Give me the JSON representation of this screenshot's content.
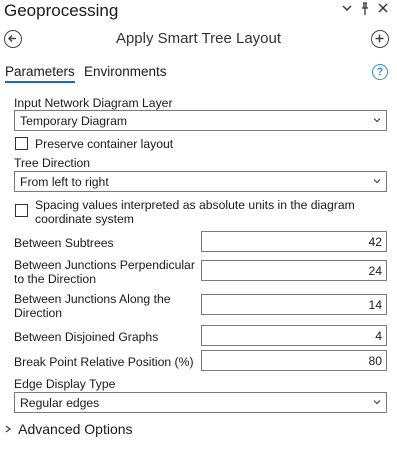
{
  "window": {
    "title": "Geoprocessing",
    "controls": [
      "chevron-down",
      "pin",
      "close"
    ]
  },
  "tool": {
    "title": "Apply Smart Tree Layout"
  },
  "tabs": [
    {
      "label": "Parameters",
      "active": true
    },
    {
      "label": "Environments",
      "active": false
    }
  ],
  "params": {
    "input_layer": {
      "label": "Input Network Diagram Layer",
      "value": "Temporary Diagram"
    },
    "preserve_container": {
      "label": "Preserve container layout",
      "checked": false
    },
    "tree_direction": {
      "label": "Tree Direction",
      "value": "From left to right"
    },
    "absolute_units": {
      "label_line1": "Spacing values interpreted as absolute units in the diagram",
      "label_line2": "coordinate system",
      "checked": false
    },
    "between_subtrees": {
      "label": "Between Subtrees",
      "value": "42"
    },
    "junctions_perpendicular": {
      "label_line1": "Between Junctions Perpendicular",
      "label_line2": "to the Direction",
      "value": "24"
    },
    "junctions_along": {
      "label_line1": "Between Junctions Along the",
      "label_line2": "Direction",
      "value": "14"
    },
    "disjoined_graphs": {
      "label": "Between Disjoined Graphs",
      "value": "4"
    },
    "break_point": {
      "label": "Break Point Relative Position (%)",
      "value": "80"
    },
    "edge_display": {
      "label": "Edge Display Type",
      "value": "Regular edges"
    }
  },
  "advanced": {
    "label": "Advanced Options"
  },
  "colors": {
    "accent": "#1a6cb5",
    "help": "#3a8fd9",
    "border": "#7a7a7a"
  }
}
